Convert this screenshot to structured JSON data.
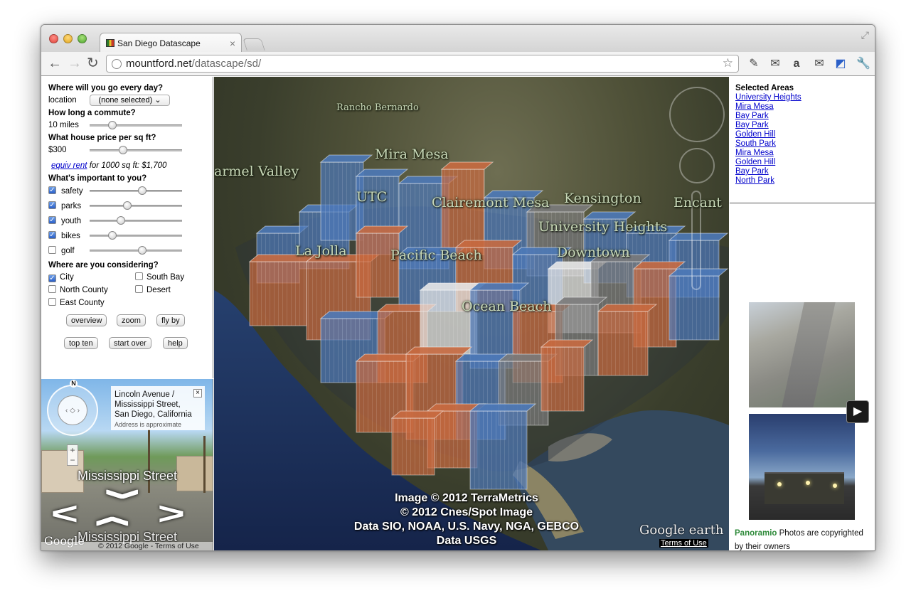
{
  "browser": {
    "tab_title": "San Diego Datascape",
    "url_domain": "mountford.net",
    "url_path": "/datascape/sd/"
  },
  "controls": {
    "q1": "Where will you go every day?",
    "location_label": "location",
    "location_value": "(none selected)",
    "q2": "How long a commute?",
    "commute_value": "10 miles",
    "commute_level": 0.22,
    "q3": "What house price per sq ft?",
    "price_value": "$300",
    "price_level": 0.35,
    "equiv_link": "equiv rent",
    "equiv_text": "for 1000 sq ft: $1,700",
    "q4": "What's important to you?",
    "priorities": [
      {
        "label": "safety",
        "checked": true,
        "level": 0.58
      },
      {
        "label": "parks",
        "checked": true,
        "level": 0.4
      },
      {
        "label": "youth",
        "checked": true,
        "level": 0.32
      },
      {
        "label": "bikes",
        "checked": true,
        "level": 0.22
      },
      {
        "label": "golf",
        "checked": false,
        "level": 0.58
      }
    ],
    "q5": "Where are you considering?",
    "regions": [
      {
        "label": "City",
        "checked": true
      },
      {
        "label": "South Bay",
        "checked": false
      },
      {
        "label": "North County",
        "checked": false
      },
      {
        "label": "Desert",
        "checked": false
      },
      {
        "label": "East County",
        "checked": false
      }
    ],
    "buttons": [
      "overview",
      "zoom",
      "fly by",
      "top ten",
      "start over",
      "help"
    ]
  },
  "streetview": {
    "address_line1": "Lincoln Avenue /",
    "address_line2": "Mississippi Street,",
    "address_line3": "San Diego, California",
    "approx": "Address is approximate",
    "street_top": "Mississippi Street",
    "street_bottom": "Mississippi Street",
    "compass_n": "N",
    "footer": "© 2012 Google - Terms of Use",
    "google": "Google"
  },
  "map": {
    "labels": [
      "Rancho Bernardo",
      "Mira Mesa",
      "armel Valley",
      "UTC",
      "Clairemont Mesa",
      "Kensington",
      "Encant",
      "University Heights",
      "La Jolla",
      "Pacific Beach",
      "Downtown",
      "Ocean Beach"
    ],
    "attribution": [
      "Image © 2012 TerraMetrics",
      "© 2012 Cnes/Spot Image",
      "Data SIO, NOAA, U.S. Navy, NGA, GEBCO",
      "Data USGS"
    ],
    "brand": "Google earth",
    "terms": "Terms of Use",
    "colors": {
      "blue": "#4d79b8",
      "orange": "#c86a40",
      "white": "#e8e8e8",
      "grey": "#7a7a7a"
    }
  },
  "selected": {
    "heading": "Selected Areas",
    "items": [
      "University Heights",
      "Mira Mesa",
      "Bay Park",
      "Bay Park",
      "Golden Hill",
      "South Park",
      "Mira Mesa",
      "Golden Hill",
      "Bay Park",
      "North Park"
    ]
  },
  "photos": {
    "brand": "Panoramio",
    "caption": "Photos are copyrighted by their owners"
  }
}
